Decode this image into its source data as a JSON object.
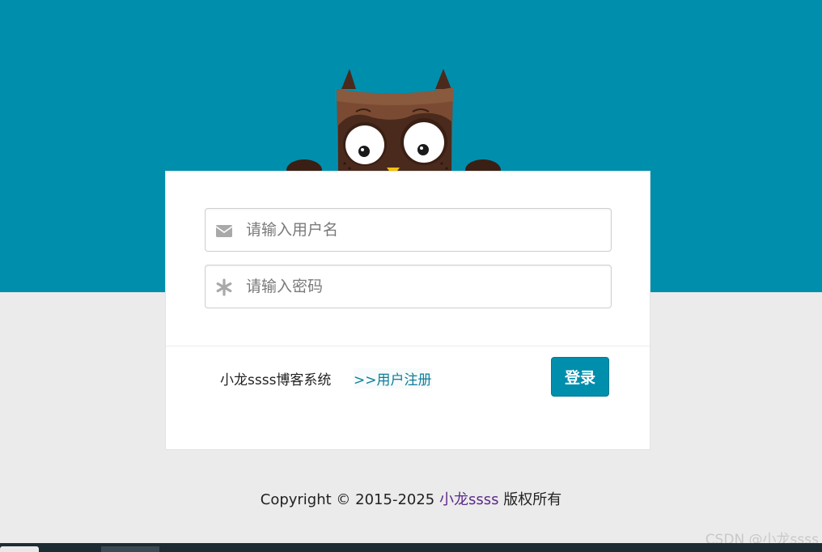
{
  "login_form": {
    "username_placeholder": "请输入用户名",
    "password_placeholder": "请输入密码",
    "site_name": "小龙ssss博客系统",
    "register_link": ">>用户注册",
    "login_button": "登录"
  },
  "footer": {
    "copyright_prefix": "Copyright © 2015-2025 ",
    "owner": "小龙ssss",
    "rights": " 版权所有"
  },
  "watermark": "CSDN @小龙ssss",
  "icons": {
    "username": "envelope-icon",
    "password": "asterisk-icon",
    "mascot": "owl-mascot"
  },
  "colors": {
    "primary": "#008ead",
    "background": "#ebebeb",
    "card": "#ffffff",
    "link": "#0e7d99",
    "owner_link": "#5b2a8a"
  }
}
